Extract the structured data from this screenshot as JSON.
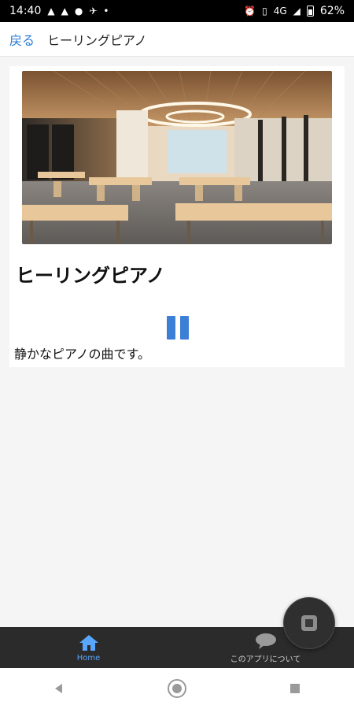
{
  "status_bar": {
    "time": "14:40",
    "network": "4G",
    "battery": "62%"
  },
  "header": {
    "back_label": "戻る",
    "title": "ヒーリングピアノ"
  },
  "content": {
    "title": "ヒーリングピアノ",
    "description": "静かなピアノの曲です。"
  },
  "tabs": [
    {
      "label": "Home",
      "icon": "home-icon"
    },
    {
      "label": "このアプリについて",
      "icon": "chat-bubble-icon"
    }
  ],
  "colors": {
    "accent": "#3c7fd7",
    "link": "#2b7cd6",
    "tabbar": "#2b2b2b"
  }
}
